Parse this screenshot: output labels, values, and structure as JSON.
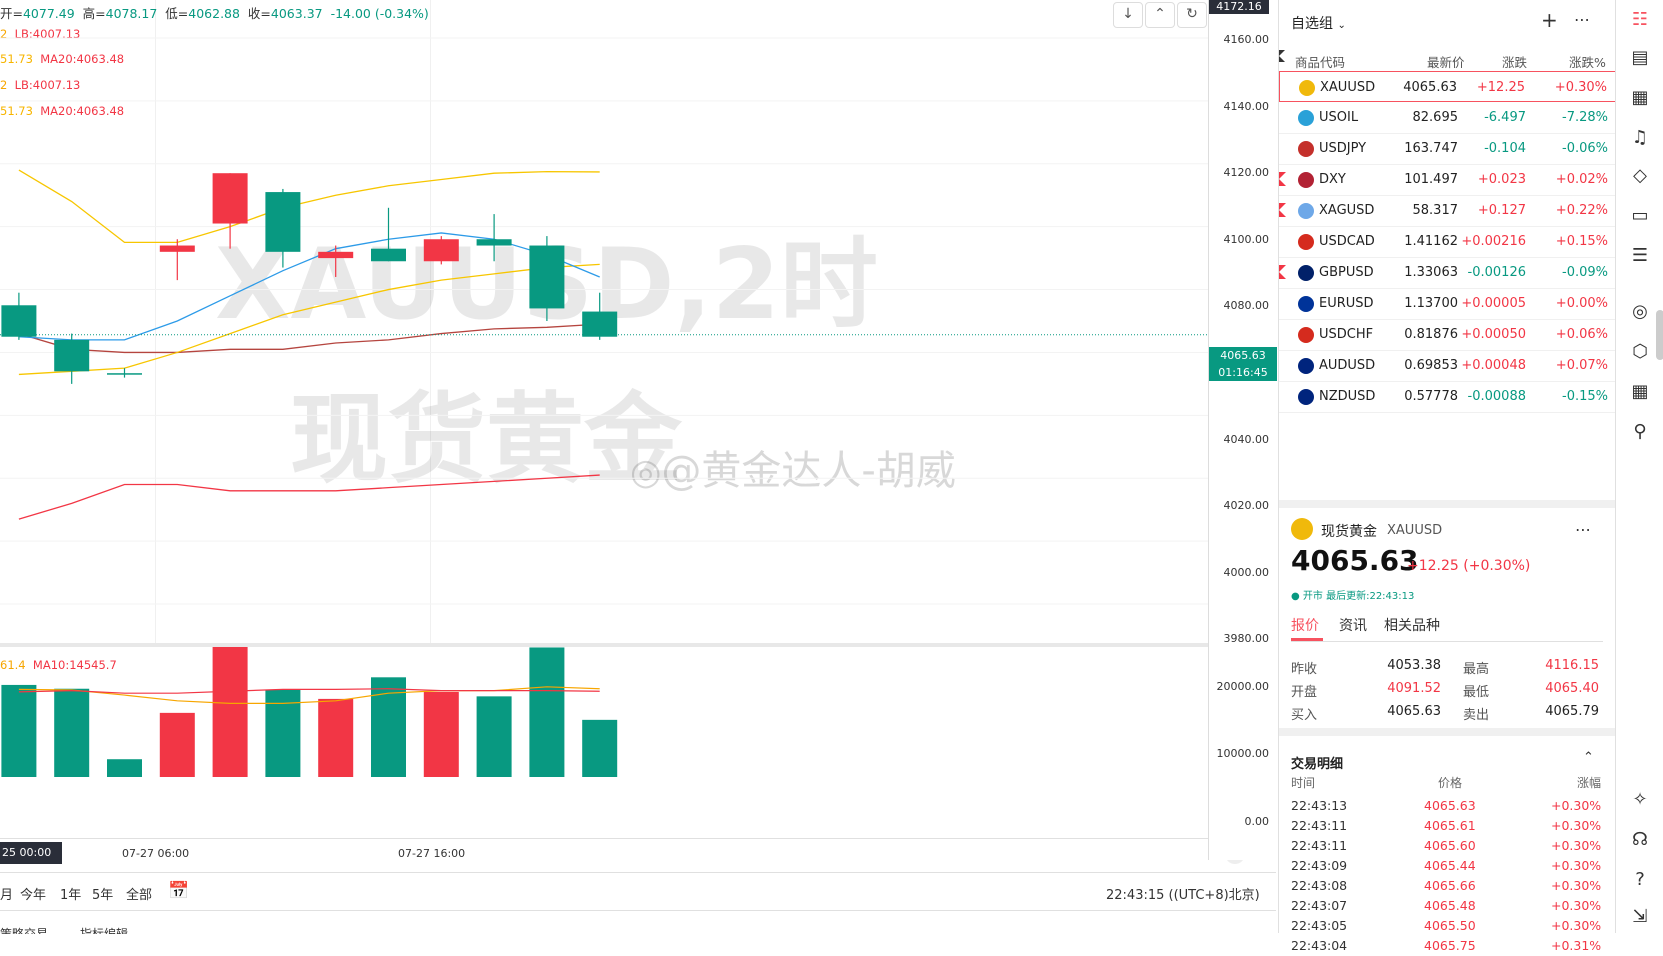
{
  "top_info": {
    "open_label": "开=",
    "open": "4077.49",
    "high_label": "高=",
    "high": "4078.17",
    "low_label": "低=",
    "low": "4062.88",
    "close_label": "收=",
    "close": "4063.37",
    "change": "-14.00 (-0.34%)"
  },
  "indicators": [
    {
      "a": "2",
      "b": "LB:4007.13",
      "color_a": "#f7a600",
      "color_b": "#f23645"
    },
    {
      "a": "51.73",
      "b": "MA20:4063.48",
      "color_a": "#f7c600",
      "color_b": "#f23645"
    },
    {
      "a": "2",
      "b": "LB:4007.13",
      "color_a": "#f7a600",
      "color_b": "#f23645"
    },
    {
      "a": "51.73",
      "b": "MA20:4063.48",
      "color_a": "#f7c600",
      "color_b": "#f23645"
    }
  ],
  "vol_indicator": {
    "a": "61.4",
    "b": "MA10:14545.7"
  },
  "watermark": {
    "line1": "XAUUSD,2时",
    "line2": "现货黄金",
    "author": "@黄金达人-胡威"
  },
  "price_axis": {
    "top_badge": "4172.16",
    "ticks": [
      "4160.00",
      "4140.00",
      "4120.00",
      "4100.00",
      "4080.00",
      "4040.00",
      "4020.00",
      "4000.00",
      "3980.00"
    ],
    "current_price": "4065.63",
    "countdown": "01:16:45"
  },
  "volume_axis": {
    "ticks": [
      "20000.00",
      "10000.00",
      "0.00"
    ]
  },
  "time_axis": {
    "left_badge": "25  00:00",
    "labels": [
      "07-27 06:00",
      "07-27 16:00"
    ],
    "auto_label": "A"
  },
  "bottom_bar": {
    "ranges": [
      "月",
      "今年",
      "1年",
      "5年",
      "全部"
    ],
    "clock": "22:43:15 ((UTC+8)北京)",
    "bottom_cut": [
      "策略交易",
      "指标编辑"
    ]
  },
  "chart_data": {
    "type": "candlestick",
    "price_range": [
      3980,
      4172.16
    ],
    "volume_range": [
      0,
      22000
    ],
    "candles": [
      {
        "o": 4075,
        "h": 4079,
        "l": 4064,
        "c": 4065,
        "dir": "down"
      },
      {
        "o": 4064,
        "h": 4066,
        "l": 4050,
        "c": 4054,
        "dir": "down"
      },
      {
        "o": 4053,
        "h": 4055,
        "l": 4052,
        "c": 4053.4,
        "dir": "down"
      },
      {
        "o": 4092,
        "h": 4096,
        "l": 4083,
        "c": 4094,
        "dir": "up"
      },
      {
        "o": 4101,
        "h": 4117,
        "l": 4093,
        "c": 4117,
        "dir": "up"
      },
      {
        "o": 4111,
        "h": 4112,
        "l": 4087,
        "c": 4092,
        "dir": "down"
      },
      {
        "o": 4090,
        "h": 4094,
        "l": 4084,
        "c": 4092,
        "dir": "up"
      },
      {
        "o": 4089,
        "h": 4106,
        "l": 4089,
        "c": 4093,
        "dir": "down"
      },
      {
        "o": 4089,
        "h": 4097,
        "l": 4088,
        "c": 4096,
        "dir": "up"
      },
      {
        "o": 4096,
        "h": 4104,
        "l": 4089,
        "c": 4094,
        "dir": "down"
      },
      {
        "o": 4094,
        "h": 4097,
        "l": 4070,
        "c": 4074,
        "dir": "down"
      },
      {
        "o": 4073,
        "h": 4079,
        "l": 4064,
        "c": 4065,
        "dir": "down"
      }
    ],
    "volumes": [
      14500,
      13900,
      2800,
      10100,
      20700,
      13700,
      12300,
      15700,
      13400,
      12700,
      20400,
      9000
    ],
    "vol_dirs": [
      "down",
      "down",
      "down",
      "up",
      "up",
      "down",
      "up",
      "down",
      "up",
      "down",
      "down",
      "down"
    ],
    "bollinger_upper": [
      4118,
      4108,
      4095,
      4095,
      4100,
      4106,
      4110,
      4113,
      4115,
      4117,
      4117.5,
      4117.4
    ],
    "bollinger_mid": [
      4066,
      4061,
      4060,
      4060,
      4061,
      4061,
      4063,
      4064,
      4066,
      4067.5,
      4068,
      4069
    ],
    "bollinger_lower": [
      4007,
      4012,
      4018,
      4018,
      4016,
      4016,
      4016,
      4017,
      4018,
      4019,
      4020,
      4021
    ],
    "ma_blue": [
      4065,
      4064,
      4064,
      4070,
      4078,
      4086,
      4093,
      4096,
      4098,
      4096,
      4091,
      4084
    ],
    "ma_yellow": [
      4053,
      4054,
      4055,
      4060,
      4066,
      4072,
      4076,
      4080,
      4083,
      4085,
      4087,
      4088
    ],
    "vol_ma_orange": [
      13800,
      13700,
      12900,
      12000,
      11600,
      11600,
      12000,
      13200,
      13600,
      13600,
      14200,
      13900
    ],
    "vol_ma_red": [
      13400,
      13600,
      13200,
      13200,
      13500,
      13800,
      13800,
      13900,
      13600,
      13600,
      13600,
      13500
    ]
  },
  "watchlist": {
    "group_label": "自选组",
    "headers": {
      "symbol": "商品代码",
      "last": "最新价",
      "chg": "涨跌",
      "pct": "涨跌%"
    },
    "rows": [
      {
        "sym": "XAUUSD",
        "last": "4065.63",
        "chg": "+12.25",
        "pct": "+0.30%",
        "dir": "up",
        "flag": "#f0b90b",
        "marker": false,
        "selected": true
      },
      {
        "sym": "USOIL",
        "last": "82.695",
        "chg": "-6.497",
        "pct": "-7.28%",
        "dir": "down",
        "flag": "#2aa1d8",
        "marker": false,
        "selected": false
      },
      {
        "sym": "USDJPY",
        "last": "163.747",
        "chg": "-0.104",
        "pct": "-0.06%",
        "dir": "down",
        "flag": "#c4302b",
        "marker": false,
        "selected": false
      },
      {
        "sym": "DXY",
        "last": "101.497",
        "chg": "+0.023",
        "pct": "+0.02%",
        "dir": "up",
        "flag": "#b22234",
        "marker": true,
        "selected": false
      },
      {
        "sym": "XAGUSD",
        "last": "58.317",
        "chg": "+0.127",
        "pct": "+0.22%",
        "dir": "up",
        "flag": "#6ea8e8",
        "marker": true,
        "selected": false
      },
      {
        "sym": "USDCAD",
        "last": "1.41162",
        "chg": "+0.00216",
        "pct": "+0.15%",
        "dir": "up",
        "flag": "#d52b1e",
        "marker": false,
        "selected": false
      },
      {
        "sym": "GBPUSD",
        "last": "1.33063",
        "chg": "-0.00126",
        "pct": "-0.09%",
        "dir": "down",
        "flag": "#012169",
        "marker": true,
        "selected": false
      },
      {
        "sym": "EURUSD",
        "last": "1.13700",
        "chg": "+0.00005",
        "pct": "+0.00%",
        "dir": "up",
        "flag": "#003399",
        "marker": false,
        "selected": false
      },
      {
        "sym": "USDCHF",
        "last": "0.81876",
        "chg": "+0.00050",
        "pct": "+0.06%",
        "dir": "up",
        "flag": "#d52b1e",
        "marker": false,
        "selected": false
      },
      {
        "sym": "AUDUSD",
        "last": "0.69853",
        "chg": "+0.00048",
        "pct": "+0.07%",
        "dir": "up",
        "flag": "#00247d",
        "marker": false,
        "selected": false
      },
      {
        "sym": "NZDUSD",
        "last": "0.57778",
        "chg": "-0.00088",
        "pct": "-0.15%",
        "dir": "down",
        "flag": "#00247d",
        "marker": false,
        "selected": false
      }
    ]
  },
  "detail": {
    "name": "现货黄金",
    "symbol": "XAUUSD",
    "price": "4065.63",
    "change": "+12.25 (+0.30%)",
    "status": "● 开市  最后更新:22:43:13",
    "tabs": [
      "报价",
      "资讯",
      "相关品种"
    ],
    "stats": [
      {
        "label": "昨收",
        "value": "4053.38",
        "color": "#222"
      },
      {
        "label": "最高",
        "value": "4116.15",
        "color": "#f23645"
      },
      {
        "label": "开盘",
        "value": "4091.52",
        "color": "#f23645"
      },
      {
        "label": "最低",
        "value": "4065.40",
        "color": "#f23645"
      },
      {
        "label": "买入",
        "value": "4065.63",
        "color": "#222"
      },
      {
        "label": "卖出",
        "value": "4065.79",
        "color": "#222"
      }
    ]
  },
  "trades": {
    "title": "交易明细",
    "headers": {
      "time": "时间",
      "price": "价格",
      "pct": "涨幅"
    },
    "rows": [
      {
        "time": "22:43:13",
        "price": "4065.63",
        "pct": "+0.30%"
      },
      {
        "time": "22:43:11",
        "price": "4065.61",
        "pct": "+0.30%"
      },
      {
        "time": "22:43:11",
        "price": "4065.60",
        "pct": "+0.30%"
      },
      {
        "time": "22:43:09",
        "price": "4065.44",
        "pct": "+0.30%"
      },
      {
        "time": "22:43:08",
        "price": "4065.66",
        "pct": "+0.30%"
      },
      {
        "time": "22:43:07",
        "price": "4065.48",
        "pct": "+0.30%"
      },
      {
        "time": "22:43:05",
        "price": "4065.50",
        "pct": "+0.30%"
      },
      {
        "time": "22:43:04",
        "price": "4065.75",
        "pct": "+0.31%"
      }
    ]
  },
  "colors": {
    "up": "#f23645",
    "down": "#089981",
    "accent": "#f7525f"
  }
}
